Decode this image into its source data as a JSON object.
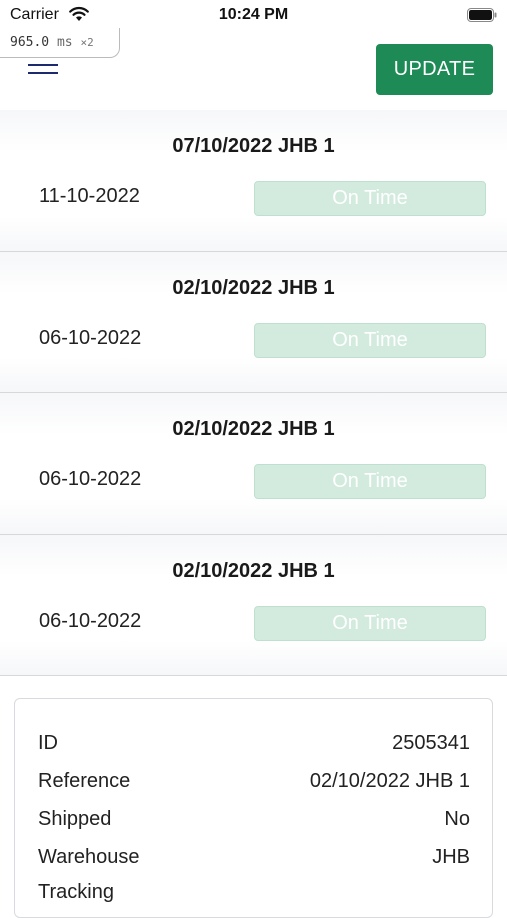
{
  "status_bar": {
    "carrier": "Carrier",
    "time": "10:24 PM"
  },
  "perf_badge": {
    "value": "965.0",
    "unit": "ms",
    "multiplier": "×2"
  },
  "header": {
    "menu_icon": "hamburger-menu-icon",
    "update_label": "UPDATE",
    "update_color": "#1e8a55"
  },
  "list": {
    "items": [
      {
        "title": "07/10/2022 JHB 1",
        "date": "11-10-2022",
        "status": "On Time"
      },
      {
        "title": "02/10/2022 JHB 1",
        "date": "06-10-2022",
        "status": "On Time"
      },
      {
        "title": "02/10/2022 JHB 1",
        "date": "06-10-2022",
        "status": "On Time"
      },
      {
        "title": "02/10/2022 JHB 1",
        "date": "06-10-2022",
        "status": "On Time"
      }
    ]
  },
  "details": {
    "rows": [
      {
        "label": "ID",
        "value": "2505341"
      },
      {
        "label": "Reference",
        "value": "02/10/2022 JHB 1"
      },
      {
        "label": "Shipped",
        "value": "No"
      },
      {
        "label": "Warehouse",
        "value": "JHB"
      },
      {
        "label": "Tracking",
        "value": ""
      }
    ]
  },
  "colors": {
    "accent": "#1e8a55",
    "status_badge_bg": "#d2ebde",
    "menu_icon": "#1e2a6e"
  }
}
